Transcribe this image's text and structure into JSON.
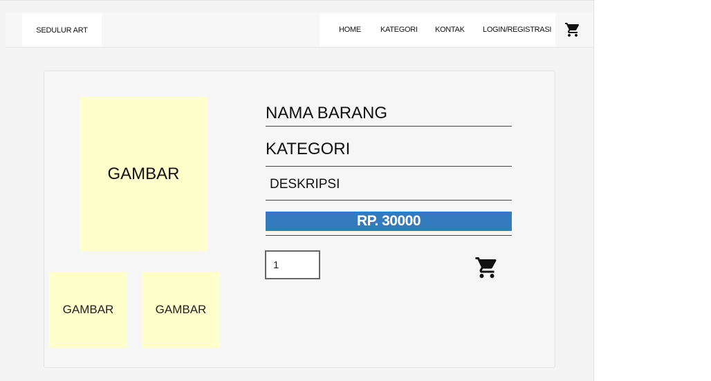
{
  "navbar": {
    "brand": "SEDULUR ART",
    "links": [
      "HOME",
      "KATEGORI",
      "KONTAK",
      "LOGIN/REGISTRASI"
    ],
    "cart_icon": "shopping-cart-icon"
  },
  "product": {
    "main_image_label": "GAMBAR",
    "thumbnails": [
      "GAMBAR",
      "GAMBAR"
    ],
    "name": "NAMA BARANG",
    "category": "KATEGORI",
    "description": "DESKRIPSI",
    "price": "RP. 30000",
    "quantity": "1",
    "add_to_cart_icon": "shopping-cart-icon"
  },
  "colors": {
    "price_bar": "#347bbd",
    "image_placeholder": "#ffffcc"
  }
}
